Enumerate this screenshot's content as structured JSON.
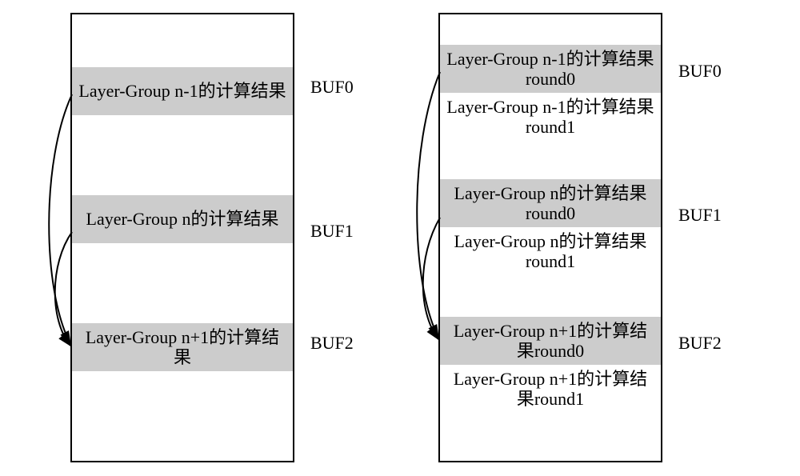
{
  "left": {
    "slot0": "Layer-Group n-1的计算结果",
    "slot1": "Layer-Group n的计算结果",
    "slot2": "Layer-Group n+1的计算结果",
    "buf0": "BUF0",
    "buf1": "BUF1",
    "buf2": "BUF2"
  },
  "right": {
    "slot0a": "Layer-Group n-1的计算结果round0",
    "slot0b": "Layer-Group n-1的计算结果round1",
    "slot1a": "Layer-Group n的计算结果round0",
    "slot1b": "Layer-Group n的计算结果round1",
    "slot2a": "Layer-Group n+1的计算结果round0",
    "slot2b": "Layer-Group n+1的计算结果round1",
    "buf0": "BUF0",
    "buf1": "BUF1",
    "buf2": "BUF2"
  }
}
